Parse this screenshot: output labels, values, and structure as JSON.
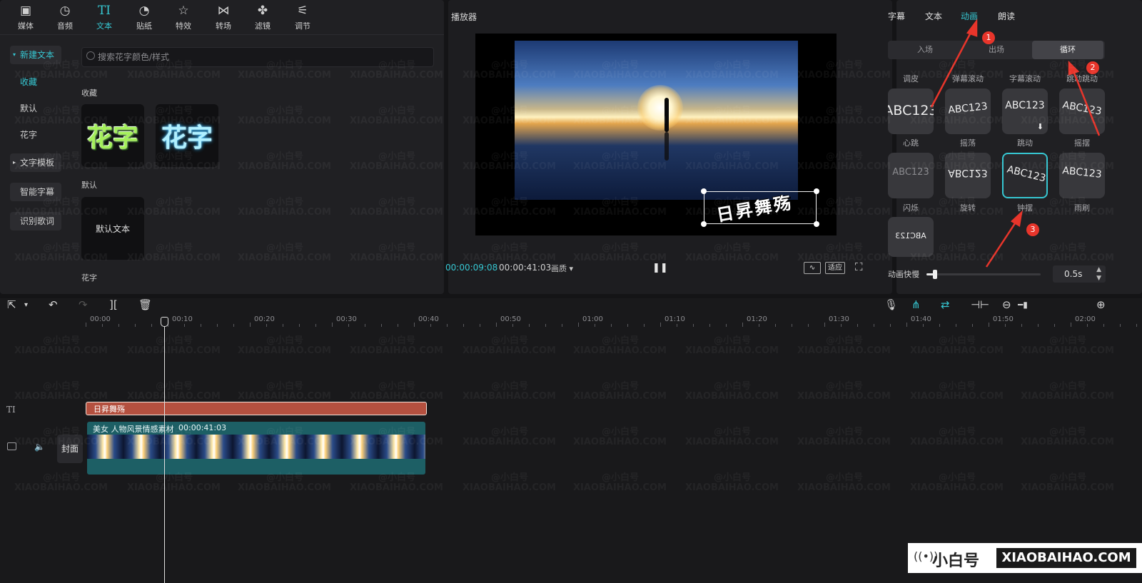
{
  "toolbar": {
    "tools": [
      {
        "label": "媒体",
        "icon": "media-icon"
      },
      {
        "label": "音频",
        "icon": "audio-icon"
      },
      {
        "label": "文本",
        "icon": "text-icon",
        "active": true
      },
      {
        "label": "贴纸",
        "icon": "sticker-icon"
      },
      {
        "label": "特效",
        "icon": "effect-icon"
      },
      {
        "label": "转场",
        "icon": "transition-icon"
      },
      {
        "label": "滤镜",
        "icon": "filter-icon"
      },
      {
        "label": "调节",
        "icon": "adjust-icon"
      }
    ]
  },
  "sidebar": {
    "items": [
      {
        "label": "新建文本"
      },
      {
        "label": "收藏"
      },
      {
        "label": "默认"
      },
      {
        "label": "花字"
      },
      {
        "label": "文字模板"
      },
      {
        "label": "智能字幕"
      },
      {
        "label": "识别歌词"
      }
    ]
  },
  "search": {
    "placeholder": "搜索花字颜色/样式"
  },
  "library": {
    "section_favorites": "收藏",
    "section_default": "默认",
    "section_huazi": "花字",
    "huazi_sample": "花字",
    "default_text": "默认文本"
  },
  "player": {
    "title": "播放器",
    "current_time": "00:00:09:08",
    "total_time": "00:00:41:03",
    "quality": "画质 ▾",
    "fit_label": "适应",
    "overlay_text": "日昇舞殇"
  },
  "right_panel": {
    "tabs": [
      {
        "label": "字幕"
      },
      {
        "label": "文本"
      },
      {
        "label": "动画",
        "active": true
      },
      {
        "label": "朗读"
      }
    ],
    "segments": [
      {
        "label": "入场"
      },
      {
        "label": "出场"
      },
      {
        "label": "循环",
        "active": true
      }
    ],
    "header_labels": [
      "调皮",
      "弹幕滚动",
      "字幕滚动",
      "跳动跳动"
    ],
    "animations": [
      {
        "sample": "ABC123",
        "label": "心跳"
      },
      {
        "sample": "ABC123",
        "label": "摇荡"
      },
      {
        "sample": "ABC123",
        "label": "跳动"
      },
      {
        "sample": "ABC123",
        "label": "摇摆"
      },
      {
        "sample": "ABC123",
        "label": "闪烁"
      },
      {
        "sample": "ABC123",
        "label": "旋转"
      },
      {
        "sample": "ABC123",
        "label": "钟摆",
        "selected": true
      },
      {
        "sample": "ABC123",
        "label": "雨刷"
      },
      {
        "sample": "ABC123",
        "label": ""
      }
    ],
    "speed_label": "动画快慢",
    "speed_value": "0.5s",
    "speed_fraction": 0.07
  },
  "annotations": [
    "1",
    "2",
    "3"
  ],
  "timeline": {
    "ruler": [
      "00:00",
      "00:10",
      "00:20",
      "00:30",
      "00:40",
      "00:50",
      "01:00",
      "01:10",
      "01:20",
      "01:30",
      "01:40",
      "01:50",
      "02:00"
    ],
    "text_clip": "日昇舞殇",
    "video_clip_title": "美女 人物风景情感素材",
    "video_clip_duration": "00:00:41:03",
    "cover_label": "封面"
  },
  "watermark": {
    "site": "XIAOBAIHAO.COM",
    "brand": "@小白号",
    "logo_cn": "小白号",
    "logo_en": "XIAOBAIHAO.COM"
  },
  "colors": {
    "accent": "#36c7d2",
    "panel_bg": "#202023",
    "clip_text": "#b4503f",
    "clip_video": "#1d5f65",
    "annotation": "#e8352b"
  }
}
